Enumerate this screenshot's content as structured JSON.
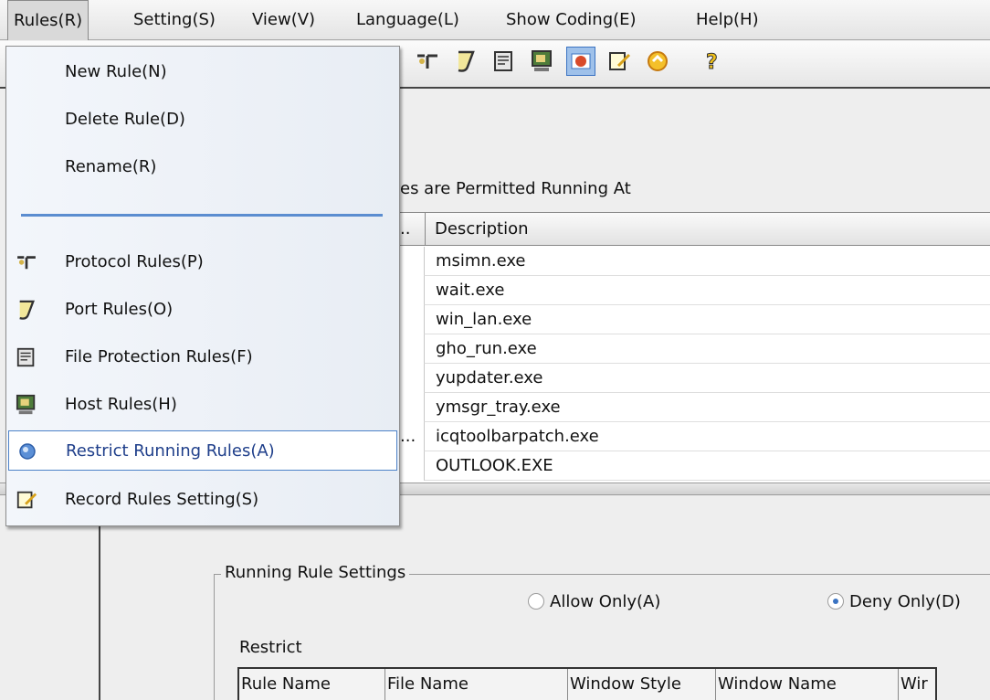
{
  "menubar": {
    "items": [
      {
        "label": "Rules(R)"
      },
      {
        "label": "Setting(S)"
      },
      {
        "label": "View(V)"
      },
      {
        "label": "Language(L)"
      },
      {
        "label": "Show Coding(E)"
      },
      {
        "label": "Help(H)"
      }
    ]
  },
  "toolbar": {
    "icons": [
      "protocol-rules-icon",
      "port-rules-icon",
      "file-protection-icon",
      "host-rules-icon",
      "restrict-running-icon",
      "record-rules-icon",
      "update-icon",
      "help-icon"
    ]
  },
  "rules_menu": {
    "items": [
      {
        "label": "New Rule(N)"
      },
      {
        "label": "Delete Rule(D)"
      },
      {
        "label": "Rename(R)"
      },
      {
        "label": "Protocol Rules(P)",
        "icon": "protocol-rules-icon"
      },
      {
        "label": "Port Rules(O)",
        "icon": "port-rules-icon"
      },
      {
        "label": "File Protection Rules(F)",
        "icon": "file-protection-icon"
      },
      {
        "label": "Host Rules(H)",
        "icon": "host-rules-icon"
      },
      {
        "label": "Restrict Running Rules(A)",
        "icon": "restrict-running-icon",
        "selected": true
      },
      {
        "label": "Record Rules Setting(S)",
        "icon": "record-rules-icon"
      }
    ]
  },
  "process_panel": {
    "title": "es are Permitted Running At",
    "col1": "..",
    "col2": "Description",
    "rows": [
      {
        "trunc": "",
        "name": "msimn.exe"
      },
      {
        "trunc": "",
        "name": "wait.exe"
      },
      {
        "trunc": "",
        "name": "win_lan.exe"
      },
      {
        "trunc": "",
        "name": "gho_run.exe"
      },
      {
        "trunc": "",
        "name": "yupdater.exe"
      },
      {
        "trunc": "",
        "name": "ymsgr_tray.exe"
      },
      {
        "trunc": "...",
        "name": "icqtoolbarpatch.exe"
      },
      {
        "trunc": "",
        "name": "OUTLOOK.EXE"
      }
    ]
  },
  "running_settings": {
    "title": "Running Rule Settings",
    "allow_label": "Allow Only(A)",
    "deny_label": "Deny Only(D)",
    "selected": "deny",
    "restrict_label": "Restrict",
    "columns": [
      "Rule Name",
      "File Name",
      "Window Style",
      "Window Name",
      "Wir"
    ]
  },
  "colors": {
    "selection_border": "#4d82c8",
    "separator": "#5b8dd0",
    "active_toolbar": "#9fc1ea"
  }
}
